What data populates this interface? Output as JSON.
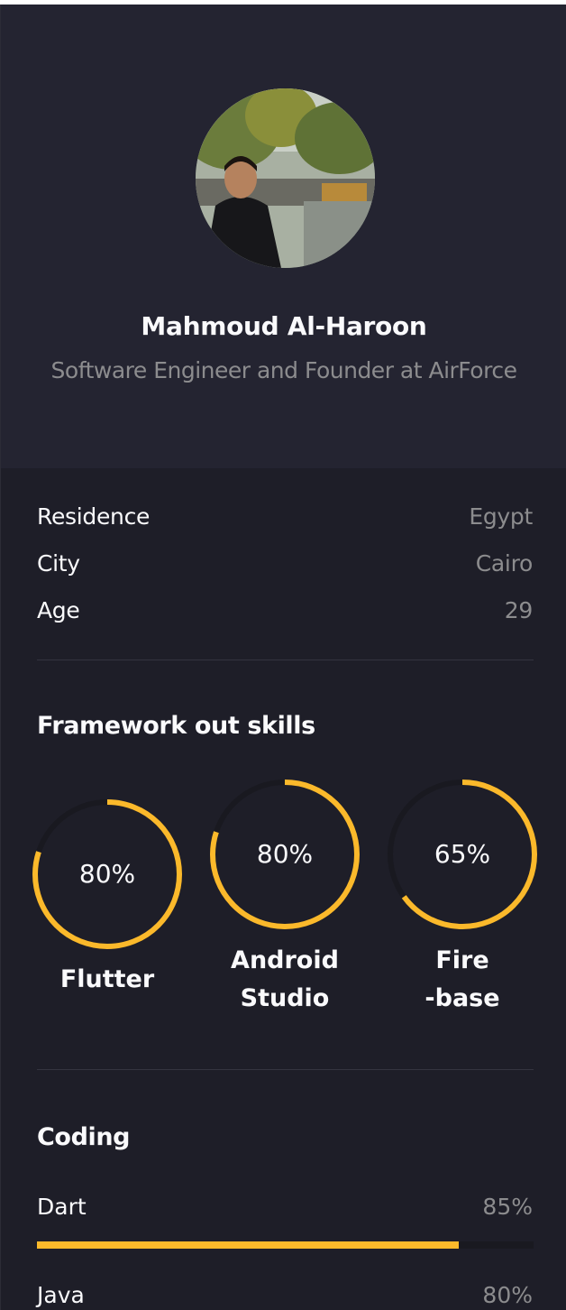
{
  "profile": {
    "name": "Mahmoud Al-Haroon",
    "title": "Software Engineer and Founder at AirForce"
  },
  "info": [
    {
      "label": "Residence",
      "value": "Egypt"
    },
    {
      "label": "City",
      "value": "Cairo"
    },
    {
      "label": "Age",
      "value": "29"
    }
  ],
  "frameworks": {
    "title": "Framework out skills",
    "skills": [
      {
        "percent_label": "80%",
        "value": 0.8,
        "label_lines": [
          "Flutter"
        ]
      },
      {
        "percent_label": "80%",
        "value": 0.8,
        "label_lines": [
          "Android",
          "Studio"
        ]
      },
      {
        "percent_label": "65%",
        "value": 0.65,
        "label_lines": [
          "Fire",
          "-base"
        ]
      }
    ]
  },
  "coding": {
    "title": "Coding",
    "items": [
      {
        "label": "Dart",
        "value_label": "85%",
        "value": 0.85
      },
      {
        "label": "Java",
        "value_label": "80%",
        "value": 0.8
      }
    ]
  },
  "colors": {
    "accent": "#fbb92b",
    "panel_bg": "#1e1e28",
    "profile_bg": "#242431",
    "ring_track": "#191920",
    "text_primary": "#fafafc",
    "text_secondary": "#8c8c8e"
  }
}
